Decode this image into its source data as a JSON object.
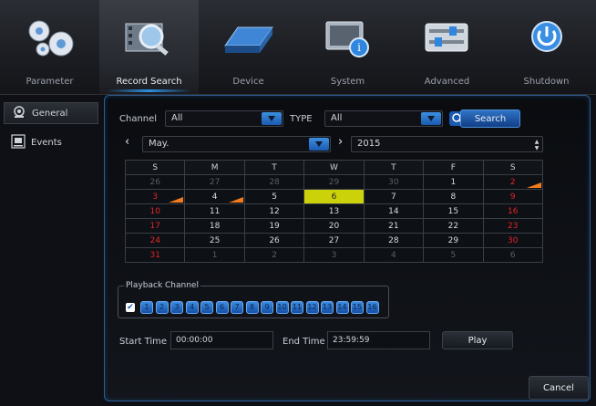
{
  "tabs": [
    {
      "label": "Parameter",
      "icon": "gears-icon"
    },
    {
      "label": "Record Search",
      "icon": "film-search-icon"
    },
    {
      "label": "Device",
      "icon": "hard-drive-icon"
    },
    {
      "label": "System",
      "icon": "info-monitor-icon"
    },
    {
      "label": "Advanced",
      "icon": "sliders-icon"
    },
    {
      "label": "Shutdown",
      "icon": "power-icon"
    }
  ],
  "active_tab": "Record Search",
  "sidebar": {
    "items": [
      {
        "label": "General",
        "icon": "camera-icon"
      },
      {
        "label": "Events",
        "icon": "event-icon"
      }
    ]
  },
  "search": {
    "channel_label": "Channel",
    "channel_value": "All",
    "type_label": "TYPE",
    "type_value": "All",
    "search_button": "Search"
  },
  "calendar": {
    "month": "May.",
    "year": "2015",
    "weekdays": [
      "S",
      "M",
      "T",
      "W",
      "T",
      "F",
      "S"
    ],
    "weeks": [
      [
        "26",
        "27",
        "28",
        "29",
        "30",
        "1",
        "2"
      ],
      [
        "3",
        "4",
        "5",
        "6",
        "7",
        "8",
        "9"
      ],
      [
        "10",
        "11",
        "12",
        "13",
        "14",
        "15",
        "16"
      ],
      [
        "17",
        "18",
        "19",
        "20",
        "21",
        "22",
        "23"
      ],
      [
        "24",
        "25",
        "26",
        "27",
        "28",
        "29",
        "30"
      ],
      [
        "31",
        "1",
        "2",
        "3",
        "4",
        "5",
        "6"
      ]
    ],
    "selected_day": "6",
    "recorded_days": [
      "2",
      "3",
      "4"
    ]
  },
  "playback": {
    "title": "Playback Channel",
    "channels": [
      "1",
      "2",
      "3",
      "4",
      "5",
      "6",
      "7",
      "8",
      "9",
      "10",
      "11",
      "12",
      "13",
      "14",
      "15",
      "16"
    ]
  },
  "time": {
    "start_label": "Start Time",
    "start_value": "00:00:00",
    "end_label": "End Time",
    "end_value": "23:59:59",
    "play_button": "Play"
  },
  "cancel_button": "Cancel",
  "colors": {
    "accent": "#2d8fe0",
    "highlight": "#cbd20a",
    "weekend": "#e0262b",
    "record_marker": "#f07a1d"
  }
}
